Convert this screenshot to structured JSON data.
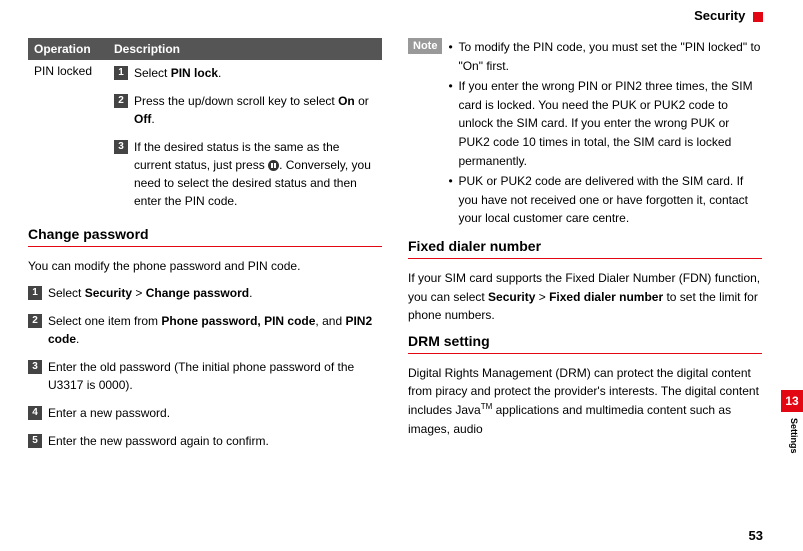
{
  "header": {
    "section": "Security"
  },
  "leftCol": {
    "tableHead": {
      "op": "Operation",
      "desc": "Description"
    },
    "row": {
      "opName": "PIN locked",
      "step1": {
        "pre": "Select ",
        "b": "PIN lock",
        "post": "."
      },
      "step2": {
        "pre": "Press the up/down scroll key to select ",
        "b1": "On",
        "mid": " or ",
        "b2": "Off",
        "post": "."
      },
      "step3": {
        "pre": "If the desired status is the same as the current status, just press ",
        "post": ". Conversely, you need to select the desired status and then enter the PIN code."
      }
    },
    "h_changepw": "Change password",
    "changepw_intro": "You can modify the phone password and PIN code.",
    "cp1": {
      "pre": "Select ",
      "b1": "Security",
      "mid": " > ",
      "b2": "Change password",
      "post": "."
    },
    "cp2": {
      "pre": "Select one item from ",
      "b1": "Phone password, PIN code",
      "mid": ", and ",
      "b2": "PIN2 code",
      "post": "."
    },
    "cp3": "Enter the old password (The initial phone password of the U3317 is 0000).",
    "cp4": "Enter a new password.",
    "cp5": "Enter the new password again to confirm."
  },
  "rightCol": {
    "noteLabel": "Note",
    "note1": "To modify the PIN code, you must set the \"PIN locked\" to \"On\" first.",
    "note2": "If you enter the wrong PIN or PIN2 three times, the SIM card is locked. You need the PUK or PUK2 code to unlock the SIM card. If you enter the wrong PUK or PUK2 code 10 times in total, the SIM card is locked permanently.",
    "note3": "PUK or PUK2 code are delivered with the SIM card. If you have not received one or have forgotten it, contact your local customer care centre.",
    "h_fdn": "Fixed dialer number",
    "fdn_body": {
      "pre": "If your SIM card supports the Fixed Dialer Number (FDN) function, you can select ",
      "b1": "Security",
      "mid": " > ",
      "b2": "Fixed dialer number",
      "post": " to set the limit for phone numbers."
    },
    "h_drm": "DRM setting",
    "drm_body": {
      "pre": "Digital Rights Management (DRM) can protect the digital content from piracy and protect the provider's interests. The digital content includes Java",
      "tm": "TM",
      "post": " applications and multimedia content such as images, audio"
    }
  },
  "side": {
    "chapter": "13",
    "label": "Settings"
  },
  "pageNumber": "53"
}
